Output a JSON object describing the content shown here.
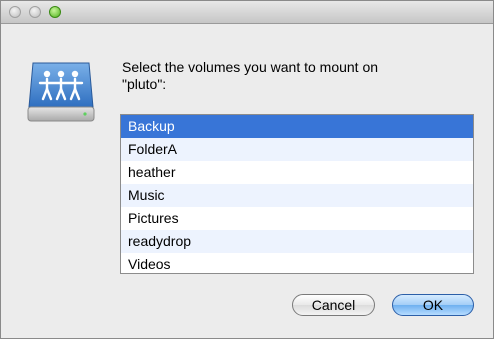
{
  "dialog": {
    "prompt_line1": "Select the volumes you want to mount on",
    "prompt_line2": "\"pluto\":",
    "icon": "network-drive-icon"
  },
  "volumes": [
    {
      "label": "Backup",
      "selected": true
    },
    {
      "label": "FolderA",
      "selected": false
    },
    {
      "label": "heather",
      "selected": false
    },
    {
      "label": "Music",
      "selected": false
    },
    {
      "label": "Pictures",
      "selected": false
    },
    {
      "label": "readydrop",
      "selected": false
    },
    {
      "label": "Videos",
      "selected": false
    }
  ],
  "buttons": {
    "cancel_label": "Cancel",
    "ok_label": "OK"
  },
  "colors": {
    "selection": "#3875d7",
    "alt_row": "#edf3fe",
    "default_button": "#6fb0f0"
  }
}
